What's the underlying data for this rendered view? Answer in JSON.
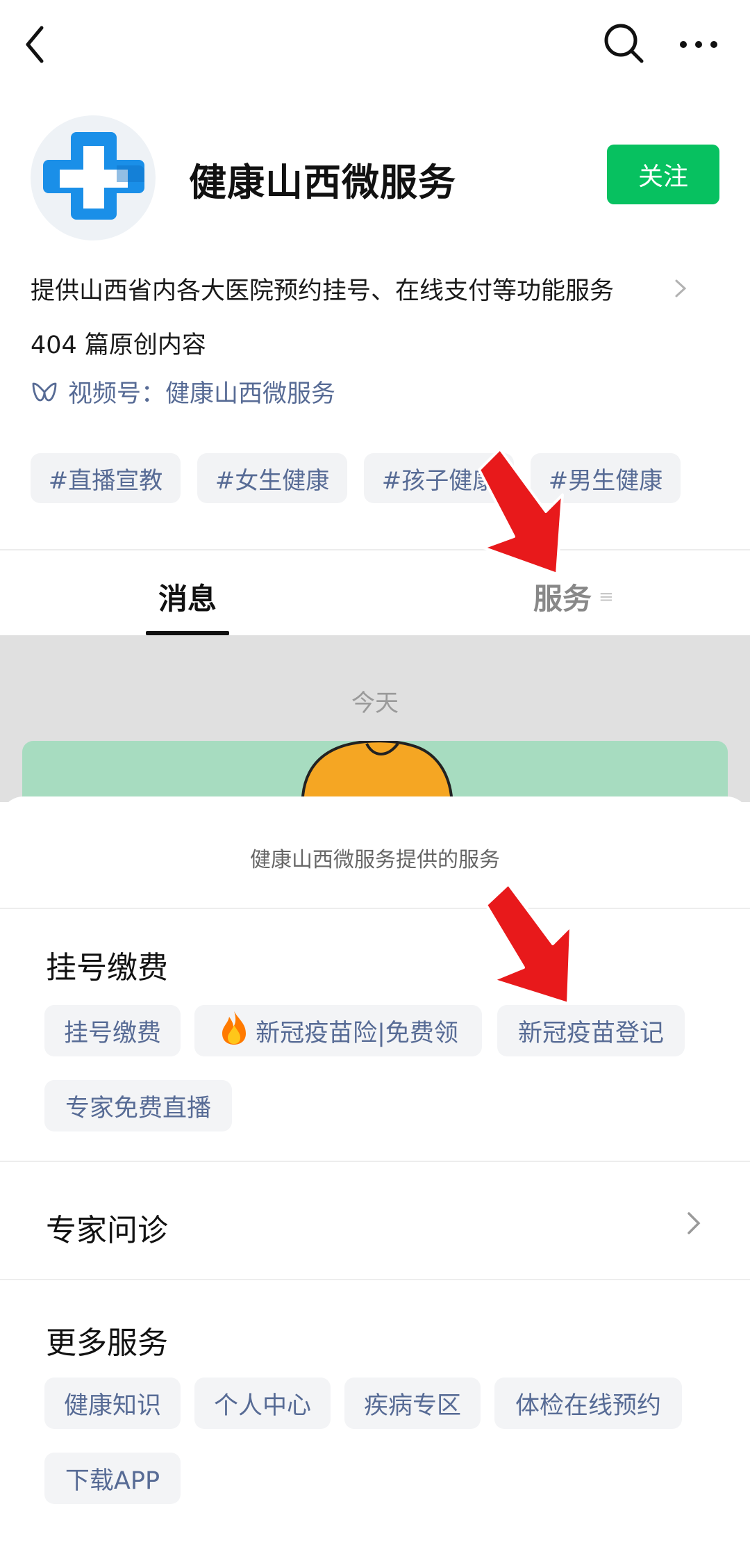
{
  "account": {
    "name": "健康山西微服务",
    "follow_label": "关注",
    "description": "提供山西省内各大医院预约挂号、在线支付等功能服务",
    "original_count": "404 篇原创内容",
    "channel_label": "视频号：健康山西微服务"
  },
  "tags": [
    "#直播宣教",
    "#女生健康",
    "#孩子健康",
    "#男生健康"
  ],
  "tabs": {
    "messages": "消息",
    "services": "服务"
  },
  "feed": {
    "date_label": "今天"
  },
  "sheet": {
    "title": "健康山西微服务提供的服务",
    "sections": [
      {
        "title": "挂号缴费",
        "items": [
          "挂号缴费",
          "新冠疫苗险|免费领",
          "新冠疫苗登记",
          "专家免费直播"
        ]
      },
      {
        "title": "专家问诊"
      },
      {
        "title": "更多服务",
        "items": [
          "健康知识",
          "个人中心",
          "疾病专区",
          "体检在线预约",
          "下载APP"
        ]
      }
    ]
  },
  "icons": {
    "back": "back-arrow-icon",
    "search": "search-icon",
    "more": "more-dots-icon",
    "avatar": "medical-cross-logo",
    "channel": "video-channel-icon",
    "fire": "fire-icon",
    "annotation": "red-arrow-annotation"
  },
  "colors": {
    "follow": "#07c160",
    "link": "#576b95",
    "annotation": "#e8191b"
  }
}
